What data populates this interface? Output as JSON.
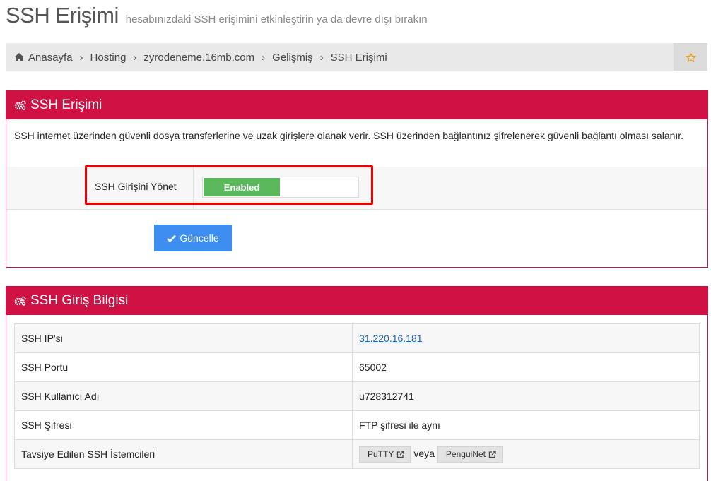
{
  "header": {
    "title": "SSH Erişimi",
    "subtitle": "hesabınızdaki SSH erişimini etkinleştirin ya da devre dışı bırakın"
  },
  "breadcrumb": [
    "Anasayfa",
    "Hosting",
    "zyrodeneme.16mb.com",
    "Gelişmiş",
    "SSH Erişimi"
  ],
  "ssh_access_panel": {
    "title": "SSH Erişimi",
    "description": "SSH internet üzerinden güvenli dosya transferlerine ve uzak girişlere olanak verir. SSH üzerinden bağlantınız şifrelenerek güvenli bağlantı olması salanır.",
    "manage_label": "SSH Girişini Yönet",
    "toggle_state": "Enabled",
    "update_label": "Güncelle"
  },
  "ssh_info_panel": {
    "title": "SSH Giriş Bilgisi",
    "rows": [
      {
        "label": "SSH IP'si",
        "value": "31.220.16.181"
      },
      {
        "label": "SSH Portu",
        "value": "65002"
      },
      {
        "label": "SSH Kullanıcı Adı",
        "value": "u728312741"
      },
      {
        "label": "SSH Şifresi",
        "value": "FTP şifresi ile aynı"
      },
      {
        "label": "Tavsiye Edilen SSH İstemcileri",
        "value": ""
      }
    ],
    "clients": [
      "PuTTY",
      "PenguiNet"
    ],
    "clients_separator": "veya"
  },
  "colors": {
    "panel_header": "#cf1144",
    "toggle_on": "#5cb85c",
    "update_button": "#3d8ef0",
    "highlight": "#ee0000",
    "star": "#e8a317"
  },
  "icons": [
    "home-icon",
    "star-icon",
    "cogs-icon",
    "check-icon",
    "external-link-icon"
  ]
}
